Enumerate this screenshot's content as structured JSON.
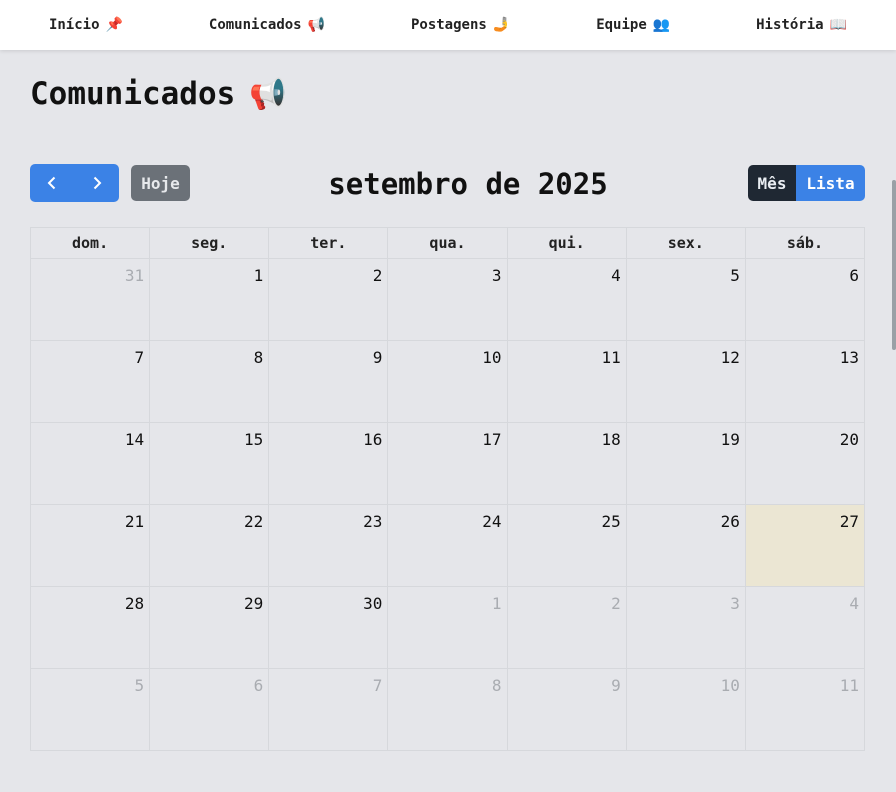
{
  "nav": {
    "items": [
      {
        "label": "Início",
        "emoji": "📌"
      },
      {
        "label": "Comunicados",
        "emoji": "📢"
      },
      {
        "label": "Postagens",
        "emoji": "🤳"
      },
      {
        "label": "Equipe",
        "emoji": "👥"
      },
      {
        "label": "História",
        "emoji": "📖"
      }
    ]
  },
  "page": {
    "title": "Comunicados",
    "title_emoji": "📢"
  },
  "calendar": {
    "today_label": "Hoje",
    "title": "setembro de 2025",
    "views": {
      "month": "Mês",
      "list": "Lista"
    },
    "active_view": "Mês",
    "weekdays": [
      "dom.",
      "seg.",
      "ter.",
      "qua.",
      "qui.",
      "sex.",
      "sáb."
    ],
    "weeks": [
      [
        "31",
        "1",
        "2",
        "3",
        "4",
        "5",
        "6"
      ],
      [
        "7",
        "8",
        "9",
        "10",
        "11",
        "12",
        "13"
      ],
      [
        "14",
        "15",
        "16",
        "17",
        "18",
        "19",
        "20"
      ],
      [
        "21",
        "22",
        "23",
        "24",
        "25",
        "26",
        "27"
      ],
      [
        "28",
        "29",
        "30",
        "1",
        "2",
        "3",
        "4"
      ],
      [
        "5",
        "6",
        "7",
        "8",
        "9",
        "10",
        "11"
      ]
    ],
    "today": "27",
    "colors": {
      "primary": "#3b82e6",
      "today_bg": "#ebe6d3",
      "other_month_text": "#a9acb1",
      "active_view_bg": "#1f2833",
      "today_button_bg": "#6b7178"
    }
  }
}
